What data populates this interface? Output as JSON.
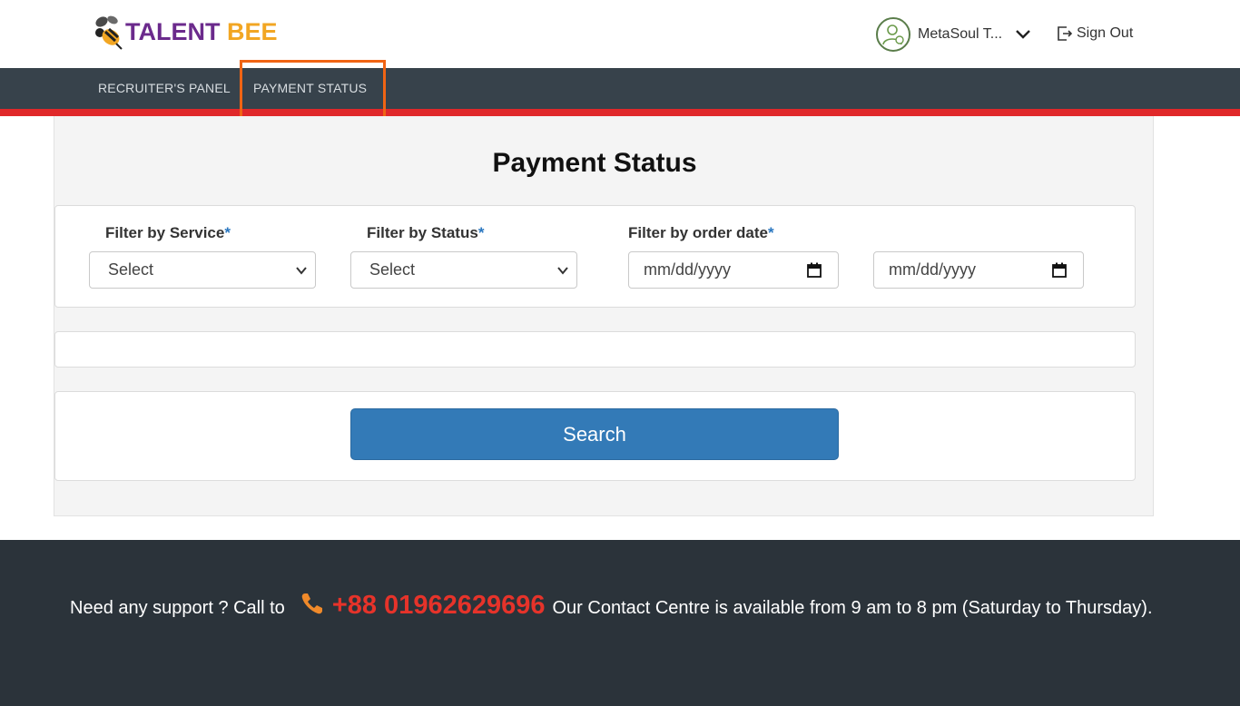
{
  "brand": {
    "word1": "TALENT",
    "word2": "BEE",
    "color1": "#6b2a8c",
    "color2": "#f2a623"
  },
  "header": {
    "user_name": "MetaSoul T...",
    "signout_label": "Sign Out"
  },
  "nav": {
    "items": [
      {
        "label": "RECRUITER'S PANEL"
      },
      {
        "label": "PAYMENT STATUS"
      }
    ],
    "active": "PAYMENT STATUS"
  },
  "page": {
    "title": "Payment Status"
  },
  "filters": {
    "service": {
      "label": "Filter by Service",
      "required": "*",
      "value": "Select"
    },
    "status": {
      "label": "Filter by Status",
      "required": "*",
      "value": "Select"
    },
    "order_date": {
      "label": "Filter by order date",
      "required": "*",
      "from_placeholder": "mm/dd/yyyy",
      "to_placeholder": "mm/dd/yyyy"
    }
  },
  "search": {
    "label": "Search"
  },
  "footer": {
    "text_before": "Need any support ? Call to",
    "phone": "+88 01962629696",
    "text_after": "Our Contact Centre is available from 9 am to 8 pm (Saturday to Thursday)."
  },
  "colors": {
    "nav_bg": "#37424b",
    "nav_accent": "#e0282a",
    "button": "#337ab7",
    "footer_bg": "#2b333a",
    "phone": "#e6332a",
    "highlight": "#f06414"
  },
  "icons": {
    "logo": "bee-icon",
    "avatar": "user-avatar-icon",
    "chevron": "chevron-down-icon",
    "signout": "sign-out-icon",
    "calendar": "calendar-icon",
    "phone": "phone-icon"
  }
}
